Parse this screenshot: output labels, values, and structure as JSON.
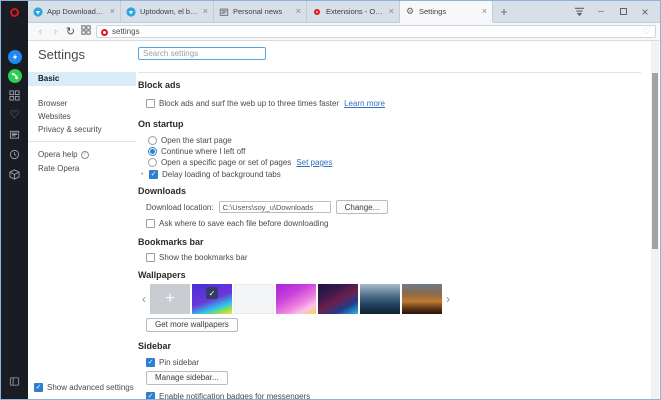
{
  "brand": {
    "name": "Opera"
  },
  "glyphs": {
    "close": "×",
    "plus": "+",
    "back": "‹",
    "forward": "›",
    "reload": "↻",
    "heart": "♡",
    "min": "–",
    "bullet": "•",
    "check": "✓",
    "chev_left": "‹",
    "chev_right": "›",
    "help": "?",
    "add": "+"
  },
  "tab_bar": {
    "tabs": [
      {
        "title": "App Downloads for Windows",
        "icon": "uptodown",
        "active": false
      },
      {
        "title": "Uptodown, el blog",
        "icon": "uptodown",
        "active": false
      },
      {
        "title": "Personal news",
        "icon": "news",
        "active": false
      },
      {
        "title": "Extensions - Opera add-ons",
        "icon": "opera",
        "active": false
      },
      {
        "title": "Settings",
        "icon": "gear",
        "active": true
      }
    ]
  },
  "toolbar": {
    "url": "settings"
  },
  "settings_nav": {
    "title": "Settings",
    "items": [
      {
        "label": "Basic",
        "active": true
      },
      {
        "label": "Browser",
        "active": false
      },
      {
        "label": "Websites",
        "active": false
      },
      {
        "label": "Privacy & security",
        "active": false
      }
    ],
    "secondary": [
      {
        "label": "Opera help"
      },
      {
        "label": "Rate Opera"
      }
    ],
    "advanced": {
      "label": "Show advanced settings",
      "checked": true
    }
  },
  "search": {
    "placeholder": "Search settings"
  },
  "sections": {
    "block_ads": {
      "heading": "Block ads",
      "checkbox": "Block ads and surf the web up to three times faster",
      "link": "Learn more",
      "checked": false
    },
    "on_startup": {
      "heading": "On startup",
      "options": [
        "Open the start page",
        "Continue where I left off",
        "Open a specific page or set of pages"
      ],
      "selected_index": 1,
      "set_pages_link": "Set pages",
      "delay_checkbox": "Delay loading of background tabs",
      "delay_checked": true
    },
    "downloads": {
      "heading": "Downloads",
      "location_label": "Download location:",
      "location_value": "C:\\Users\\soy_u\\Downloads",
      "change_button": "Change...",
      "ask_checkbox": "Ask where to save each file before downloading",
      "ask_checked": false
    },
    "bookmarks_bar": {
      "heading": "Bookmarks bar",
      "checkbox": "Show the bookmarks bar",
      "checked": false
    },
    "wallpapers": {
      "heading": "Wallpapers",
      "get_more_button": "Get more wallpapers",
      "thumbnails": [
        "add-wallpaper",
        "blue-abstract",
        "white",
        "purple-abstract",
        "dark-geometric",
        "mountain-photo",
        "city-night-photo"
      ],
      "selected_index": 1
    },
    "sidebar": {
      "heading": "Sidebar",
      "pin_checkbox": "Pin sidebar",
      "pin_checked": true,
      "manage_button": "Manage sidebar...",
      "badges_checkbox": "Enable notification badges for messengers",
      "badges_checked": true
    }
  },
  "colors": {
    "accent": "#2d7fd3",
    "link": "#3270c2",
    "opera_red": "#e0151b",
    "nav_selected_bg": "#d8ecf9",
    "rail_bg": "#191d23",
    "tabbar_bg": "#d7dfe9"
  }
}
